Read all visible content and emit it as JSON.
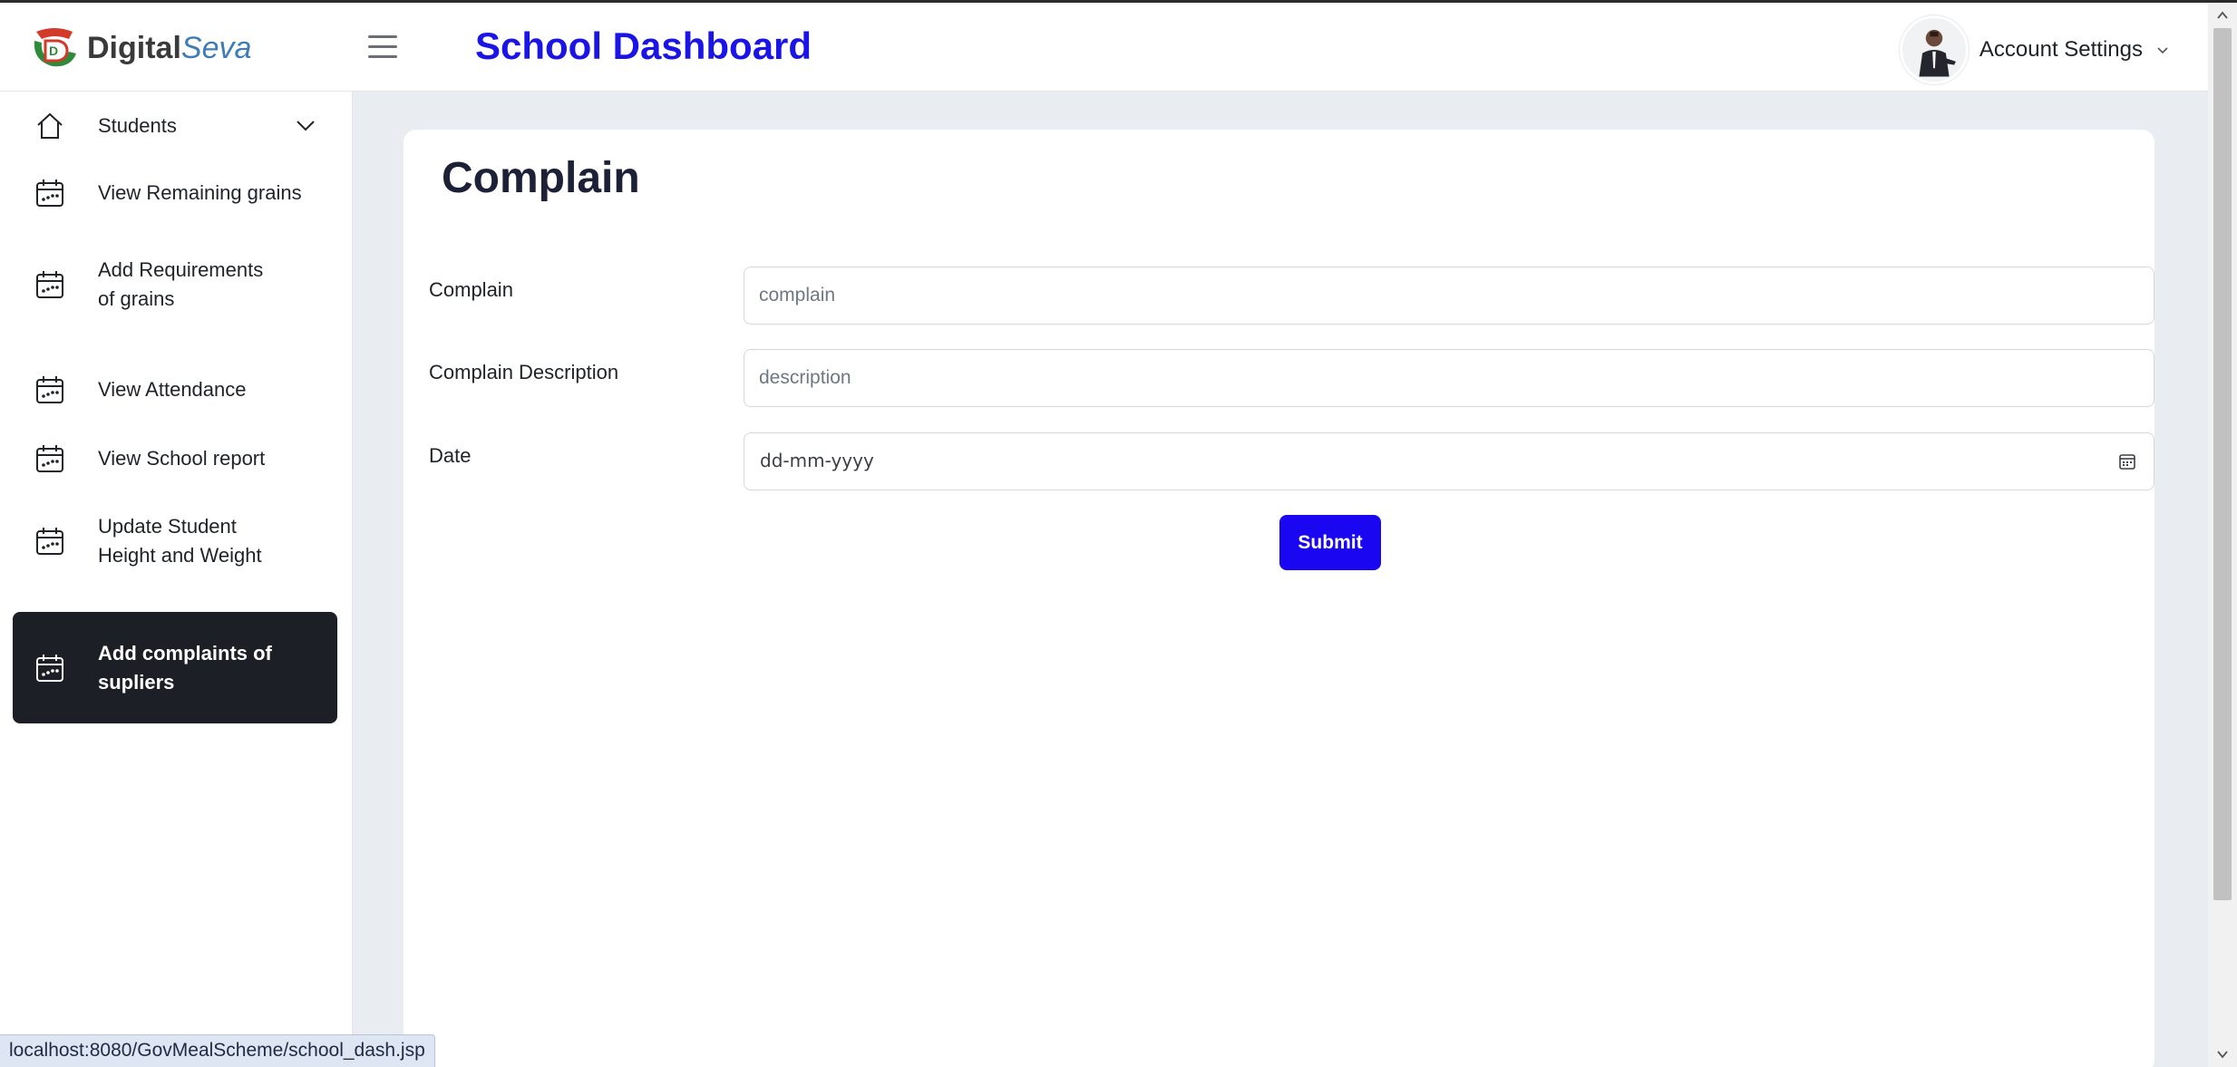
{
  "brand": {
    "name_bold": "Digital",
    "name_italic": "Seva",
    "colors": {
      "accent_red": "#d23a2a",
      "accent_green": "#2e8b3a",
      "seva_blue": "#3e7cb8"
    }
  },
  "header": {
    "title": "School Dashboard",
    "title_color": "#1a14e6",
    "account_label": "Account Settings",
    "menu_icon": "hamburger-icon"
  },
  "sidebar": {
    "items": [
      {
        "label": "Students",
        "icon": "home-icon",
        "has_submenu": true
      },
      {
        "label": "View Remaining grains",
        "icon": "calendar-icon"
      },
      {
        "label_line1": "Add Requirements",
        "label_line2": "of grains",
        "icon": "calendar-icon"
      },
      {
        "label": "View Attendance",
        "icon": "calendar-icon"
      },
      {
        "label": "View School report",
        "icon": "calendar-icon"
      },
      {
        "label_line1": "Update Student",
        "label_line2": "Height and Weight",
        "icon": "calendar-icon"
      },
      {
        "label_line1": "Add complaints of",
        "label_line2": "supliers",
        "icon": "calendar-icon",
        "active": true
      }
    ]
  },
  "main": {
    "title": "Complain",
    "form": {
      "complain_label": "Complain",
      "complain_placeholder": "complain",
      "description_label": "Complain Description",
      "description_placeholder": "description",
      "date_label": "Date",
      "date_placeholder": "dd-mm-yyyy",
      "submit_label": "Submit",
      "submit_color": "#1a06f0"
    }
  },
  "status_bar": {
    "url": "localhost:8080/GovMealScheme/school_dash.jsp"
  }
}
